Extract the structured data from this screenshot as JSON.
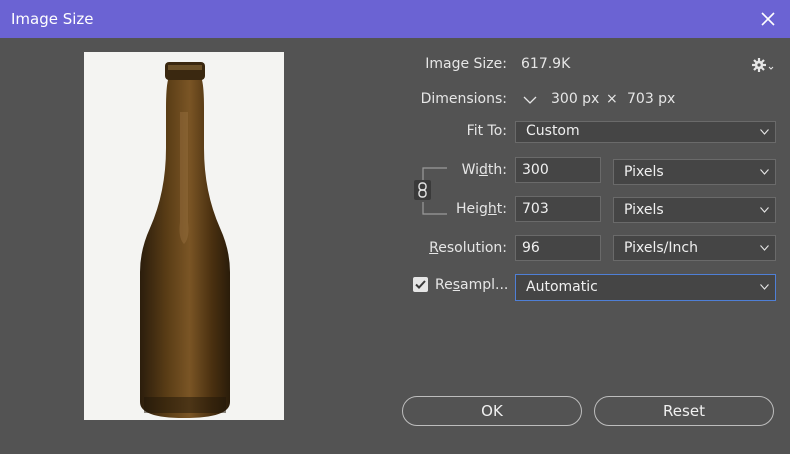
{
  "window": {
    "title": "Image Size"
  },
  "info": {
    "image_size_label": "Image Size:",
    "image_size_value": "617.9K",
    "dimensions_label": "Dimensions:",
    "dim_width": "300 px",
    "dim_times": "×",
    "dim_height": "703 px"
  },
  "fit_to": {
    "label": "Fit To:",
    "value": "Custom"
  },
  "width": {
    "label_pre": "Wi",
    "label_ul": "d",
    "label_post": "th:",
    "value": "300",
    "unit": "Pixels"
  },
  "height": {
    "label_pre": "Heig",
    "label_ul": "h",
    "label_post": "t:",
    "value": "703",
    "unit": "Pixels"
  },
  "resolution": {
    "label_pre": "",
    "label_ul": "R",
    "label_post": "esolution:",
    "value": "96",
    "unit": "Pixels/Inch"
  },
  "resample": {
    "label_pre": "Re",
    "label_ul": "s",
    "label_post": "ampl...",
    "checked": true,
    "value": "Automatic"
  },
  "buttons": {
    "ok": "OK",
    "reset": "Reset"
  },
  "colors": {
    "titlebar": "#6b63d3",
    "background": "#535353",
    "focus": "#4f7fd6"
  }
}
